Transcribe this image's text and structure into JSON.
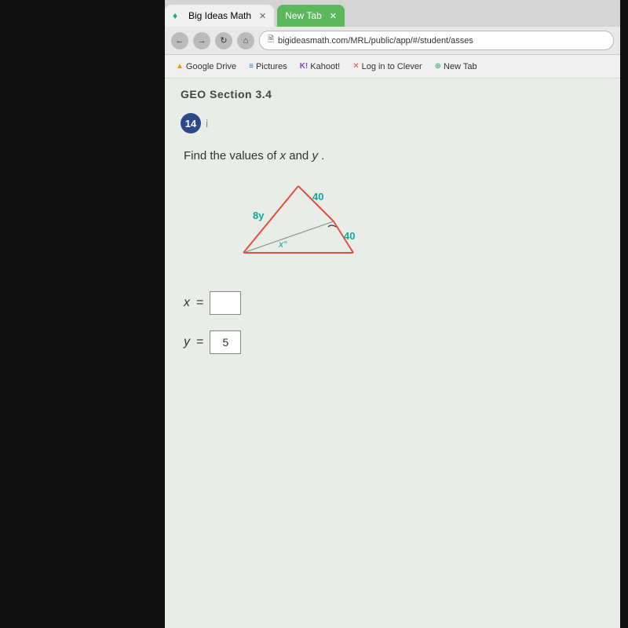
{
  "browser": {
    "tabs": [
      {
        "id": "tab-bigideas",
        "label": "Big Ideas Math",
        "active": true,
        "icon": "♦"
      },
      {
        "id": "tab-newtab",
        "label": "New Tab",
        "active": false,
        "icon": ""
      }
    ],
    "address_bar": {
      "url": "bigideasmath.com/MRL/public/app/#/student/asses",
      "url_icon": "🗎"
    },
    "bookmarks": [
      {
        "id": "bk-drive",
        "label": "Google Drive",
        "icon": "▲"
      },
      {
        "id": "bk-pictures",
        "label": "Pictures",
        "icon": "≡"
      },
      {
        "id": "bk-kahoot",
        "label": "Kahoot!",
        "icon": "K!"
      },
      {
        "id": "bk-clever",
        "label": "Log in to Clever",
        "icon": "✕"
      },
      {
        "id": "bk-newtab",
        "label": "New Tab",
        "icon": "⊕"
      }
    ]
  },
  "page": {
    "section_title": "GEO Section 3.4",
    "question_number": "14",
    "question_text": "Find the values of x and y .",
    "diagram": {
      "label_top": "40",
      "label_right": "40",
      "label_left": "8y",
      "label_angle": "x°"
    },
    "answers": [
      {
        "id": "x-answer",
        "label": "x",
        "value": ""
      },
      {
        "id": "y-answer",
        "label": "y",
        "value": "5"
      }
    ],
    "nav_buttons": [
      "←",
      "→",
      "↻",
      "⌂"
    ]
  }
}
